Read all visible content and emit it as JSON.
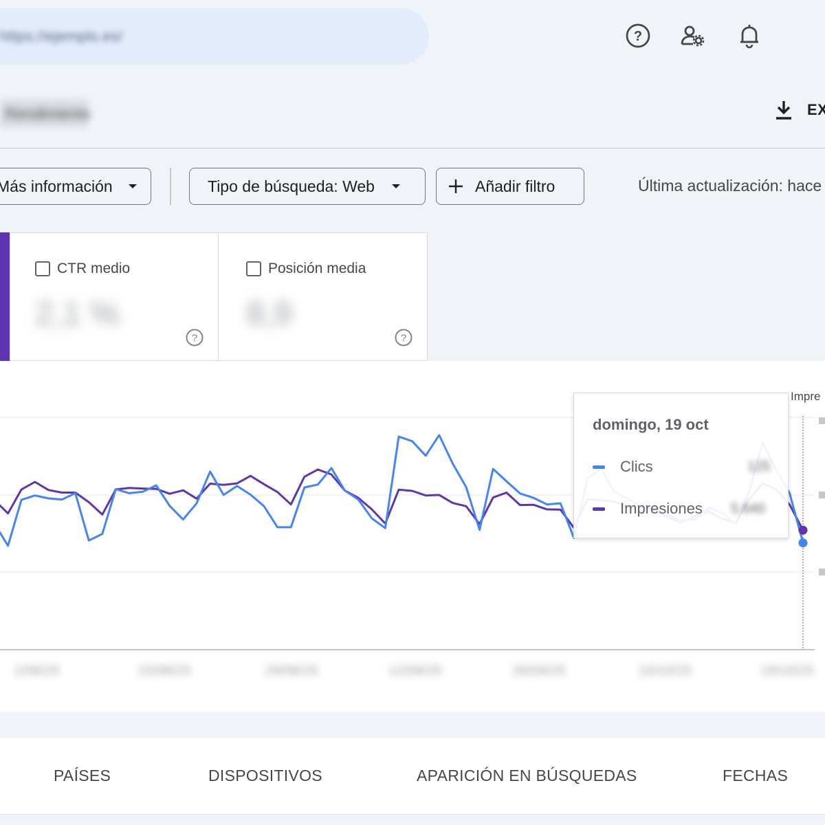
{
  "header": {
    "search_text": "https://ejemplo.es/",
    "icons": [
      "help-icon",
      "manage-users-icon",
      "notifications-icon"
    ]
  },
  "toolbar": {
    "property_name": "Rendimiento",
    "export_label": "EX"
  },
  "filters": {
    "more_info_label": "Más información",
    "search_type_label": "Tipo de búsqueda: Web",
    "add_filter_label": "Añadir filtro",
    "last_update": "Última actualización: hace"
  },
  "metrics": [
    {
      "label": "CTR medio",
      "value": "2,1 %",
      "checked": false
    },
    {
      "label": "Posición media",
      "value": "8,9",
      "checked": false
    }
  ],
  "tooltip": {
    "date": "domingo, 19 oct",
    "rows": [
      {
        "label": "Clics",
        "value": "125",
        "color": "#4285f4"
      },
      {
        "label": "Impresiones",
        "value": "5.640",
        "color": "#5e35b1"
      }
    ]
  },
  "chart_data": {
    "type": "line",
    "right_axis_title": "Impre",
    "x_tick_labels": [
      "1/08/25",
      "15/08/25",
      "29/08/25",
      "12/09/25",
      "26/09/25",
      "10/10/25",
      "19/10/25"
    ],
    "series": [
      {
        "name": "Clics",
        "color": "#4285f4",
        "values": [
          43.6,
          36.0,
          51.9,
          53.4,
          52.4,
          52.0,
          54.2,
          37.8,
          40.1,
          55.6,
          54.2,
          54.7,
          56.9,
          49.8,
          45.1,
          50.7,
          61.7,
          53.6,
          56.7,
          53.7,
          49.7,
          42.4,
          42.4,
          56.2,
          57.2,
          62.9,
          55.1,
          52.0,
          45.5,
          42.1,
          73.8,
          72.2,
          67.2,
          74.3,
          64.5,
          56.3,
          41.5,
          62.6,
          58.3,
          54.1,
          52.6,
          50.3,
          50.7,
          38.7,
          59.1,
          63.1,
          54.6,
          52.4,
          49.2,
          48.7,
          46.5,
          44.8,
          45.1,
          49.0,
          47.5,
          43.4,
          54.6,
          71.8,
          62.4,
          54.3,
          37.0
        ]
      },
      {
        "name": "Impresiones",
        "color": "#5e35b1",
        "values": [
          51.8,
          47.2,
          55.5,
          58.1,
          55.3,
          54.4,
          54.4,
          51.1,
          46.8,
          55.5,
          56.0,
          55.8,
          55.7,
          54.0,
          55.2,
          52.3,
          57.5,
          57.1,
          57.6,
          60.2,
          57.3,
          54.6,
          50.3,
          59.9,
          62.4,
          60.7,
          55.1,
          52.6,
          48.6,
          43.7,
          55.4,
          55.0,
          53.4,
          53.6,
          50.8,
          49.7,
          43.5,
          52.7,
          54.4,
          50.1,
          50.2,
          48.6,
          48.5,
          42.2,
          52.1,
          51.8,
          51.3,
          49.6,
          50.2,
          48.1,
          45.8,
          44.1,
          46.3,
          47.8,
          45.4,
          43.8,
          52.0,
          57.6,
          55.6,
          50.3,
          41.4
        ]
      }
    ],
    "ylim": [
      0,
      100
    ],
    "grid": true
  },
  "tabs": [
    "PAÍSES",
    "DISPOSITIVOS",
    "APARICIÓN EN BÚSQUEDAS",
    "FECHAS"
  ]
}
